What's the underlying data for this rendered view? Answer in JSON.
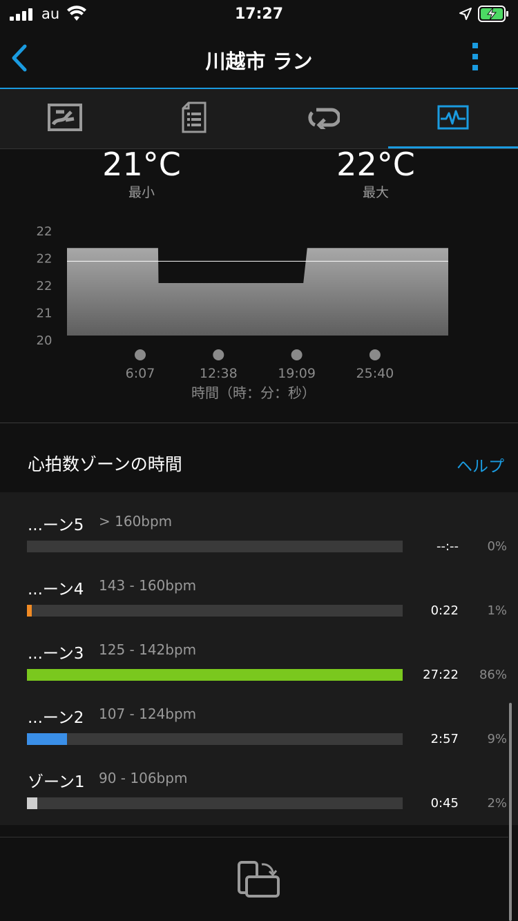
{
  "status_bar": {
    "carrier": "au",
    "time": "17:27"
  },
  "header": {
    "title": "川越市 ラン"
  },
  "tabs": [
    {
      "icon": "map-icon"
    },
    {
      "icon": "details-list-icon"
    },
    {
      "icon": "laps-icon"
    },
    {
      "icon": "graph-icon",
      "active": true
    }
  ],
  "temperature": {
    "min_value": "21°C",
    "min_label": "最小",
    "max_value": "22°C",
    "max_label": "最大"
  },
  "chart_data": {
    "type": "area",
    "title": "",
    "xlabel": "時間（時：分：秒）",
    "ylabel": "",
    "y_tick_labels": [
      "22",
      "22",
      "22",
      "21",
      "20"
    ],
    "ylim": [
      20,
      22.4
    ],
    "x_tick_labels": [
      "6:07",
      "12:38",
      "19:09",
      "25:40"
    ],
    "series": [
      {
        "points": [
          [
            0,
            22.0
          ],
          [
            0.239,
            22.0
          ],
          [
            0.24,
            21.2
          ],
          [
            0.62,
            21.2
          ],
          [
            0.63,
            22.0
          ],
          [
            1.0,
            22.0
          ]
        ]
      }
    ],
    "average_line": 21.7
  },
  "hr_zones": {
    "heading": "心拍数ゾーンの時間",
    "help_label": "ヘルプ",
    "zones": [
      {
        "name": "...ーン5",
        "range": "> 160bpm",
        "time": "--:--",
        "percent": "0%",
        "fraction": 0.0,
        "color": "#3a3a3a"
      },
      {
        "name": "...ーン4",
        "range": "143 - 160bpm",
        "time": "0:22",
        "percent": "1%",
        "fraction": 0.013,
        "color": "#f08a24"
      },
      {
        "name": "...ーン3",
        "range": "125 - 142bpm",
        "time": "27:22",
        "percent": "86%",
        "fraction": 1.0,
        "color": "#7ac81e"
      },
      {
        "name": "...ーン2",
        "range": "107 - 124bpm",
        "time": "2:57",
        "percent": "9%",
        "fraction": 0.107,
        "color": "#3a8fe8"
      },
      {
        "name": "ゾーン1",
        "range": "90 - 106bpm",
        "time": "0:45",
        "percent": "2%",
        "fraction": 0.027,
        "color": "#cfcfcf"
      }
    ]
  },
  "accent_color": "#1a9be0"
}
